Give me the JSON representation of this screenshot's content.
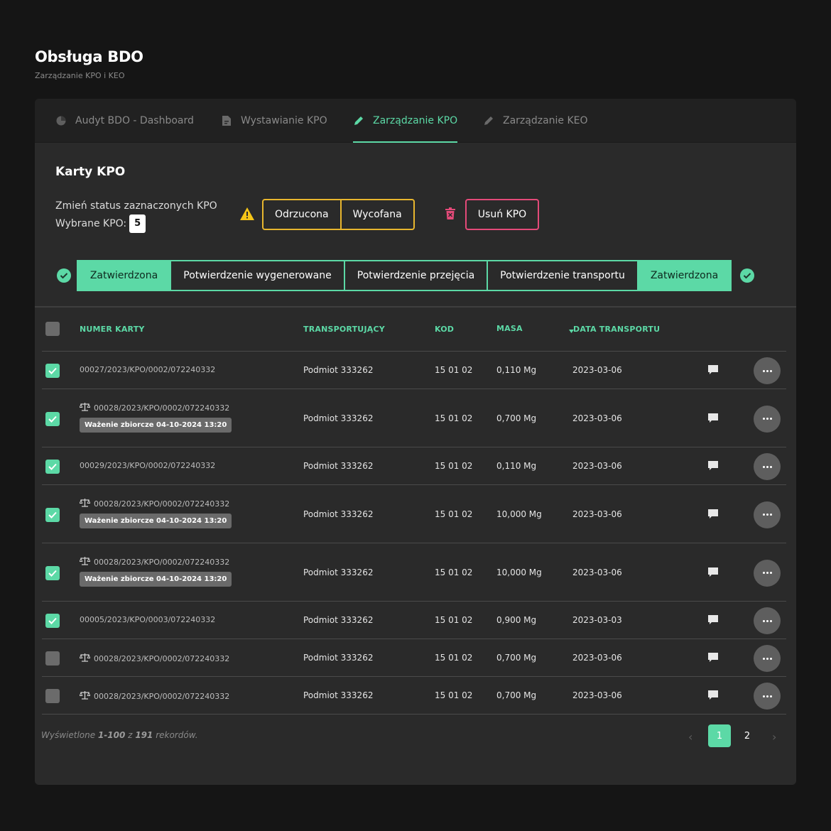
{
  "page": {
    "title": "Obsługa BDO",
    "subtitle": "Zarządzanie KPO i KEO"
  },
  "tabs": [
    {
      "label": "Audyt BDO - Dashboard",
      "icon": "pie-chart-icon"
    },
    {
      "label": "Wystawianie KPO",
      "icon": "document-icon"
    },
    {
      "label": "Zarządzanie KPO",
      "icon": "pencil-icon",
      "active": true
    },
    {
      "label": "Zarządzanie KEO",
      "icon": "pencil-icon"
    }
  ],
  "section": {
    "title": "Karty KPO",
    "change_status_label": "Zmień status zaznaczonych KPO",
    "selected_label": "Wybrane KPO:",
    "selected_count": "5",
    "status_buttons": [
      "Odrzucona",
      "Wycofana"
    ],
    "delete_label": "Usuń KPO"
  },
  "flow": [
    "Zatwierdzona",
    "Potwierdzenie wygenerowane",
    "Potwierdzenie przejęcia",
    "Potwierdzenie transportu",
    "Zatwierdzona"
  ],
  "table": {
    "headers": {
      "number": "NUMER KARTY",
      "carrier": "TRANSPORTUJĄCY",
      "code": "KOD",
      "mass": "MASA",
      "date": "DATA TRANSPORTU"
    },
    "rows": [
      {
        "checked": true,
        "scale": false,
        "number": "00027/2023/KPO/0002/072240332",
        "badge": "",
        "carrier": "Podmiot 333262",
        "code": "15 01 02",
        "mass": "0,110 Mg",
        "date": "2023-03-06"
      },
      {
        "checked": true,
        "scale": true,
        "number": "00028/2023/KPO/0002/072240332",
        "badge": "Ważenie zbiorcze 04-10-2024 13:20",
        "carrier": "Podmiot 333262",
        "code": "15 01 02",
        "mass": "0,700 Mg",
        "date": "2023-03-06"
      },
      {
        "checked": true,
        "scale": false,
        "number": "00029/2023/KPO/0002/072240332",
        "badge": "",
        "carrier": "Podmiot 333262",
        "code": "15 01 02",
        "mass": "0,110 Mg",
        "date": "2023-03-06"
      },
      {
        "checked": true,
        "scale": true,
        "number": "00028/2023/KPO/0002/072240332",
        "badge": "Ważenie zbiorcze 04-10-2024 13:20",
        "carrier": "Podmiot 333262",
        "code": "15 01 02",
        "mass": "10,000 Mg",
        "date": "2023-03-06"
      },
      {
        "checked": true,
        "scale": true,
        "number": "00028/2023/KPO/0002/072240332",
        "badge": "Ważenie zbiorcze 04-10-2024 13:20",
        "carrier": "Podmiot 333262",
        "code": "15 01 02",
        "mass": "10,000 Mg",
        "date": "2023-03-06"
      },
      {
        "checked": true,
        "scale": false,
        "number": "00005/2023/KPO/0003/072240332",
        "badge": "",
        "carrier": "Podmiot 333262",
        "code": "15 01 02",
        "mass": "0,900 Mg",
        "date": "2023-03-03"
      },
      {
        "checked": false,
        "scale": true,
        "number": "00028/2023/KPO/0002/072240332",
        "badge": "",
        "carrier": "Podmiot 333262",
        "code": "15 01 02",
        "mass": "0,700 Mg",
        "date": "2023-03-06"
      },
      {
        "checked": false,
        "scale": true,
        "number": "00028/2023/KPO/0002/072240332",
        "badge": "",
        "carrier": "Podmiot 333262",
        "code": "15 01 02",
        "mass": "0,700 Mg",
        "date": "2023-03-06"
      }
    ]
  },
  "footer": {
    "prefix": "Wyświetlone",
    "range": "1-100",
    "of": "z",
    "total": "191",
    "suffix": "rekordów."
  },
  "pagination": {
    "pages": [
      "1",
      "2"
    ],
    "current": "1"
  },
  "colors": {
    "accent": "#5cd9a6",
    "warning": "#e8b62e",
    "danger": "#e44a79"
  }
}
